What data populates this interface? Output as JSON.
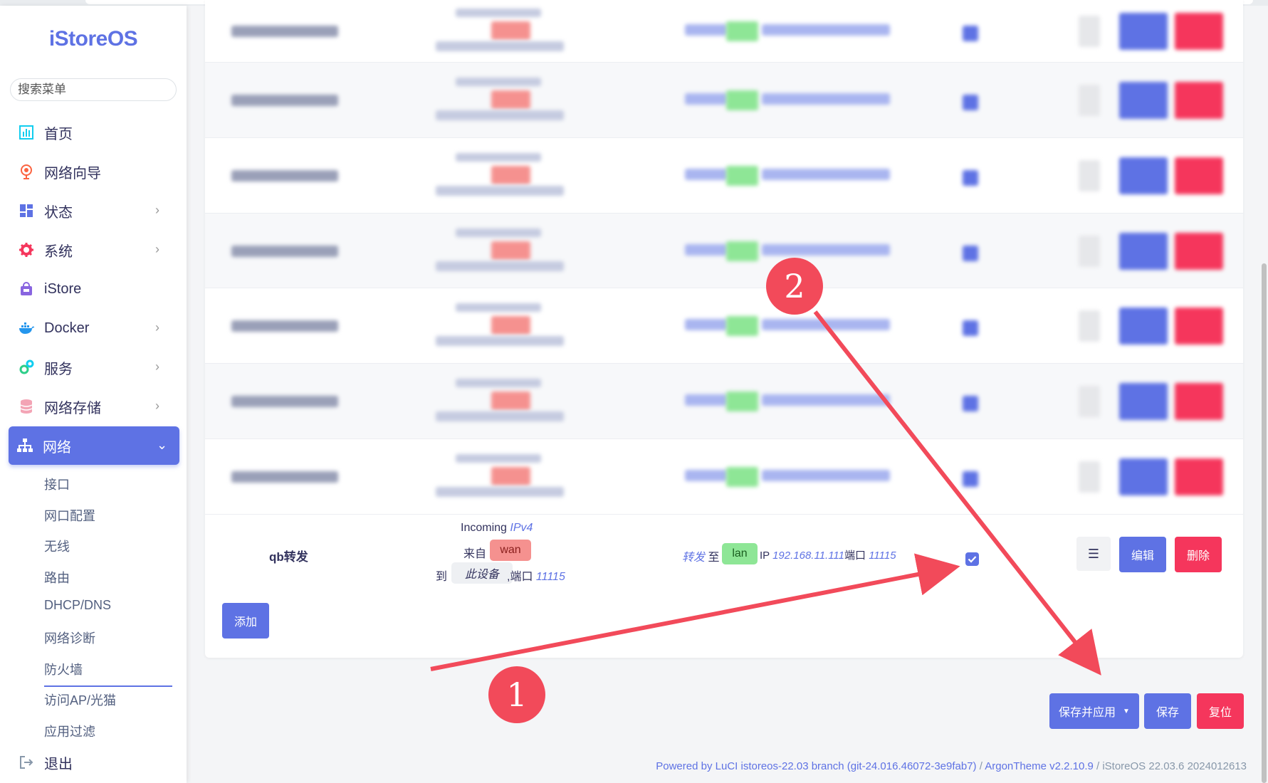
{
  "brand": {
    "logo": "iStoreOS"
  },
  "search": {
    "placeholder": "搜索菜单"
  },
  "menu": {
    "home": "首页",
    "wizard": "网络向导",
    "status": "状态",
    "system": "系统",
    "istore": "iStore",
    "docker": "Docker",
    "services": "服务",
    "storage": "网络存储",
    "network": "网络",
    "logout": "退出"
  },
  "submenu": {
    "interfaces": "接口",
    "port_config": "网口配置",
    "wireless": "无线",
    "routes": "路由",
    "dhcp": "DHCP/DNS",
    "diagnostics": "网络诊断",
    "firewall": "防火墙",
    "ap_modem": "访问AP/光猫",
    "filter": "应用过滤"
  },
  "rule": {
    "name": "qb转发",
    "incoming": "Incoming",
    "proto": "IPv4",
    "from_label": "来自",
    "from_zone": "wan",
    "to_label": "到",
    "to_device": "此设备",
    "port_sep": ",端口",
    "in_port": "11115",
    "action": "转发",
    "action_to": "至",
    "dest_zone": "lan",
    "ip_label": "IP",
    "dest_ip": "192.168.11.111",
    "port_label": "端口",
    "dest_port": "11115"
  },
  "buttons": {
    "menu": "☰",
    "edit": "编辑",
    "delete": "删除",
    "add": "添加",
    "save_apply": "保存并应用",
    "save": "保存",
    "reset": "复位"
  },
  "footer": {
    "powered": "Powered by LuCI istoreos-22.03 branch (git-24.016.46072-3e9fab7)",
    "sep1": " / ",
    "theme": "ArgonTheme v2.2.10.9",
    "sep2": " / iStoreOS 22.03.6 2024012613"
  },
  "annotations": {
    "one": "1",
    "two": "2"
  },
  "colors": {
    "primary": "#5e72e4",
    "danger": "#f5365c",
    "wan": "#f5918f",
    "lan": "#8ee696",
    "arrow": "#f24a5a"
  }
}
